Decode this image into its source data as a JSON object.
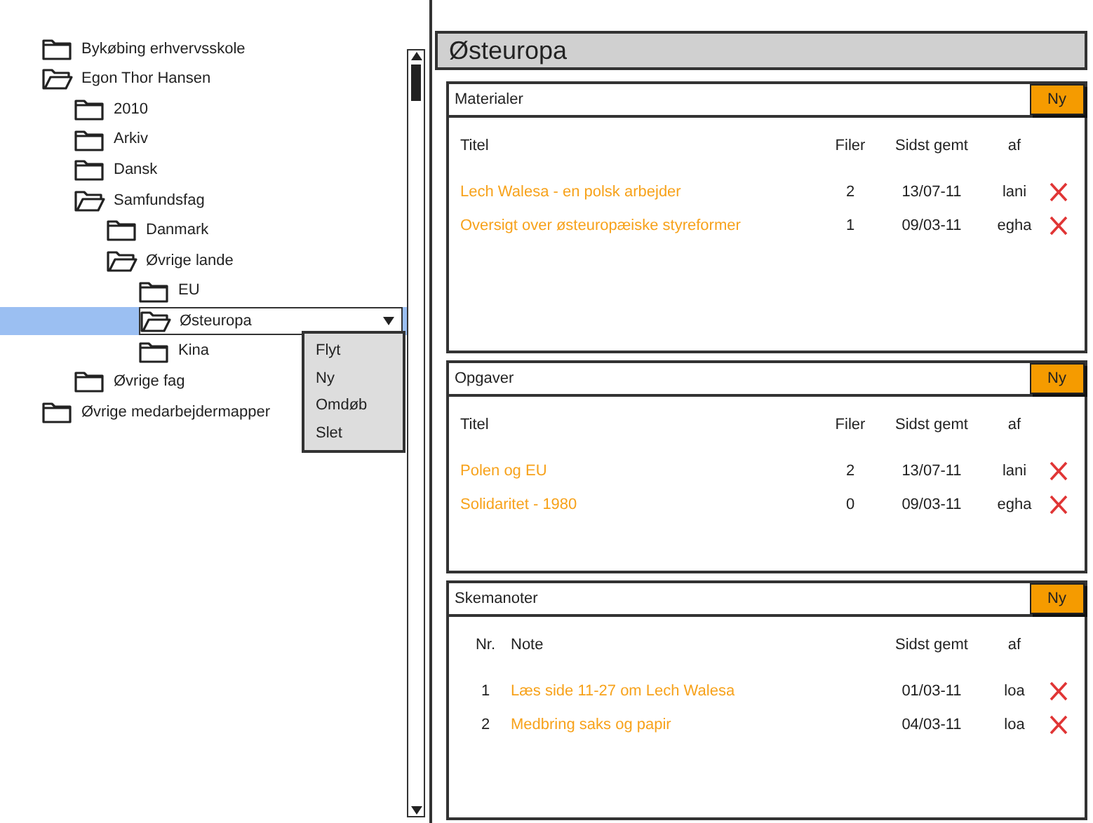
{
  "tree": {
    "items": [
      {
        "label": "Bykøbing erhvervsskole",
        "expanded": false,
        "selected": false
      },
      {
        "label": "Egon Thor Hansen",
        "expanded": true,
        "selected": false,
        "children": [
          {
            "label": "2010",
            "expanded": false,
            "selected": false
          },
          {
            "label": "Arkiv",
            "expanded": false,
            "selected": false
          },
          {
            "label": "Dansk",
            "expanded": false,
            "selected": false
          },
          {
            "label": "Samfundsfag",
            "expanded": true,
            "selected": false,
            "children": [
              {
                "label": "Danmark",
                "expanded": false,
                "selected": false
              },
              {
                "label": "Øvrige lande",
                "expanded": true,
                "selected": false,
                "children": [
                  {
                    "label": "EU",
                    "expanded": false,
                    "selected": false
                  },
                  {
                    "label": "Østeuropa",
                    "expanded": true,
                    "selected": true
                  },
                  {
                    "label": "Kina",
                    "expanded": false,
                    "selected": false
                  }
                ]
              }
            ]
          },
          {
            "label": "Øvrige fag",
            "expanded": false,
            "selected": false
          }
        ]
      },
      {
        "label": "Øvrige medarbejdermapper",
        "expanded": false,
        "selected": false
      }
    ]
  },
  "context_menu": {
    "items": [
      "Flyt",
      "Ny",
      "Omdøb",
      "Slet"
    ]
  },
  "title": "Østeuropa",
  "sections": [
    {
      "title": "Materialer",
      "kind": "files",
      "button": "Ny",
      "columns": [
        "Titel",
        "Filer",
        "Sidst gemt",
        "af"
      ],
      "rows": [
        [
          "Lech Walesa - en polsk arbejder",
          "2",
          "13/07-11",
          "lani"
        ],
        [
          "Oversigt over østeuropæiske styreformer",
          "1",
          "09/03-11",
          "egha"
        ]
      ]
    },
    {
      "title": "Opgaver",
      "kind": "files",
      "button": "Ny",
      "columns": [
        "Titel",
        "Filer",
        "Sidst gemt",
        "af"
      ],
      "rows": [
        [
          "Polen og EU",
          "2",
          "13/07-11",
          "lani"
        ],
        [
          "Solidaritet - 1980",
          "0",
          "09/03-11",
          "egha"
        ]
      ]
    },
    {
      "title": "Skemanoter",
      "kind": "notes",
      "button": "Ny",
      "columns": [
        "Nr.",
        "Note",
        "Sidst gemt",
        "af"
      ],
      "rows": [
        [
          "1",
          "Læs side 11-27 om Lech Walesa",
          "01/03-11",
          "loa"
        ],
        [
          "2",
          "Medbring saks og papir",
          "04/03-11",
          "loa"
        ]
      ]
    }
  ]
}
